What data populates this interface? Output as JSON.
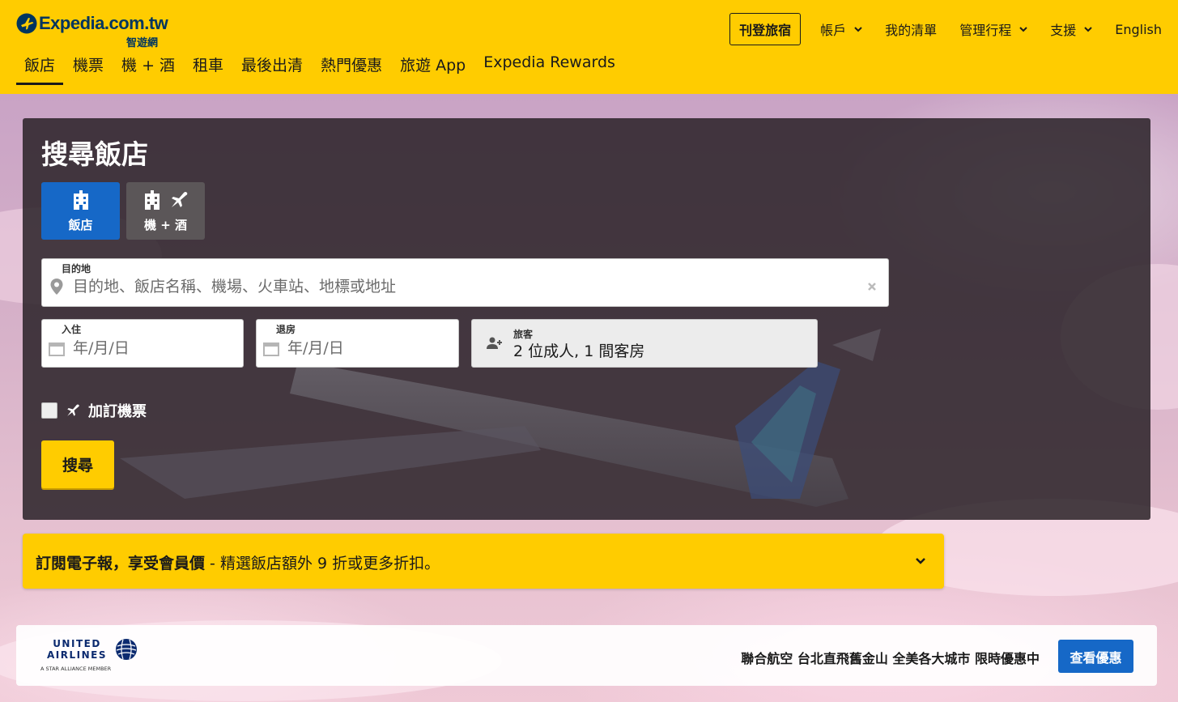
{
  "header": {
    "logo_text": "Expedia.com.tw",
    "logo_sub": "智遊網",
    "list_property": "刊登旅宿",
    "top_links": [
      "帳戶",
      "我的清單",
      "管理行程",
      "支援",
      "English"
    ],
    "main_nav": [
      "飯店",
      "機票",
      "機 + 酒",
      "租車",
      "最後出清",
      "熱門優惠",
      "旅遊 App",
      "Expedia Rewards"
    ],
    "active_tab": "飯店"
  },
  "search": {
    "title": "搜尋飯店",
    "type_hotel": "飯店",
    "type_package": "機 + 酒",
    "destination_label": "目的地",
    "destination_placeholder": "目的地、飯店名稱、機場、火車站、地標或地址",
    "checkin_label": "入住",
    "checkin_placeholder": "年/月/日",
    "checkout_label": "退房",
    "checkout_placeholder": "年/月/日",
    "travelers_label": "旅客",
    "travelers_value": "2 位成人, 1 間客房",
    "add_flight_label": "加訂機票",
    "search_button": "搜尋"
  },
  "newsletter": {
    "strong": "訂閱電子報，享受會員價",
    "rest": " - 精選飯店額外 9 折或更多折扣。"
  },
  "ad": {
    "brand_line1": "UNITED",
    "brand_line2": "AIRLINES",
    "alliance": "A STAR ALLIANCE MEMBER",
    "text": "聯合航空 台北直飛舊金山 全美各大城市 限時優惠中",
    "button": "查看優惠"
  },
  "colors": {
    "brand_yellow": "#ffcc00",
    "brand_blue": "#1668c7",
    "logo_navy": "#00355f"
  }
}
